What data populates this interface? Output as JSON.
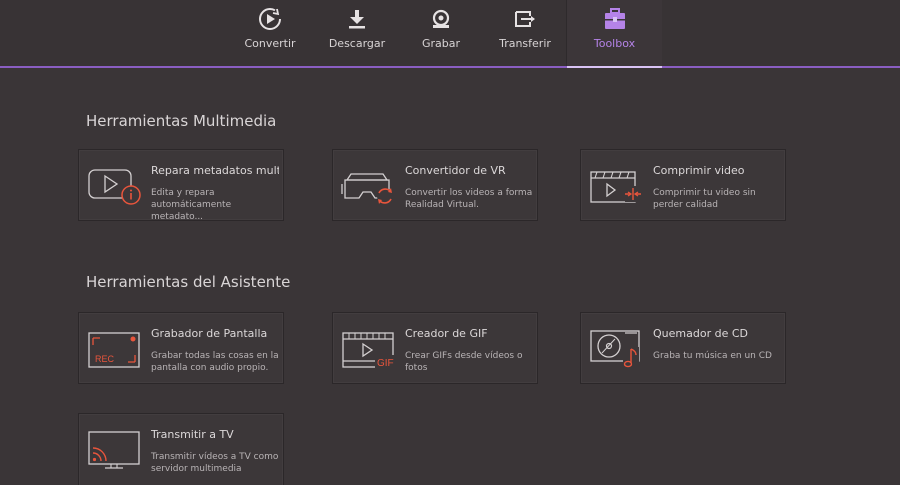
{
  "nav": {
    "tabs": [
      {
        "label": "Convertir",
        "icon": "convert-icon"
      },
      {
        "label": "Descargar",
        "icon": "download-icon"
      },
      {
        "label": "Grabar",
        "icon": "burn-icon"
      },
      {
        "label": "Transferir",
        "icon": "transfer-icon"
      },
      {
        "label": "Toolbox",
        "icon": "toolbox-icon",
        "active": true
      }
    ]
  },
  "sections": [
    {
      "title": "Herramientas Multimedia",
      "cards": [
        {
          "title": "Repara metadatos mult...",
          "desc": "Edita y repara automáticamente metadato...",
          "icon": "fix-metadata-icon"
        },
        {
          "title": "Convertidor de VR",
          "desc": "Convertir los videos a forma Realidad Virtual.",
          "icon": "vr-converter-icon"
        },
        {
          "title": "Comprimir video",
          "desc": "Comprimir tu video sin perder calidad",
          "icon": "compress-video-icon"
        }
      ]
    },
    {
      "title": "Herramientas del Asistente",
      "cards": [
        {
          "title": "Grabador de Pantalla",
          "desc": "Grabar todas las cosas en la pantalla con audio propio.",
          "icon": "screen-recorder-icon",
          "badge": "REC"
        },
        {
          "title": "Creador de GIF",
          "desc": "Crear GIFs desde vídeos o fotos",
          "icon": "gif-maker-icon",
          "badge": "GIF"
        },
        {
          "title": "Quemador de CD",
          "desc": "Graba tu música en un CD",
          "icon": "cd-burner-icon"
        },
        {
          "title": "Transmitir a TV",
          "desc": "Transmitir vídeos a TV como servidor multimedia",
          "icon": "cast-to-tv-icon"
        }
      ]
    }
  ],
  "colors": {
    "accent": "#b583e8",
    "icon_stroke": "#d4d0d1",
    "icon_highlight": "#e8553c",
    "background": "#3a3537"
  }
}
